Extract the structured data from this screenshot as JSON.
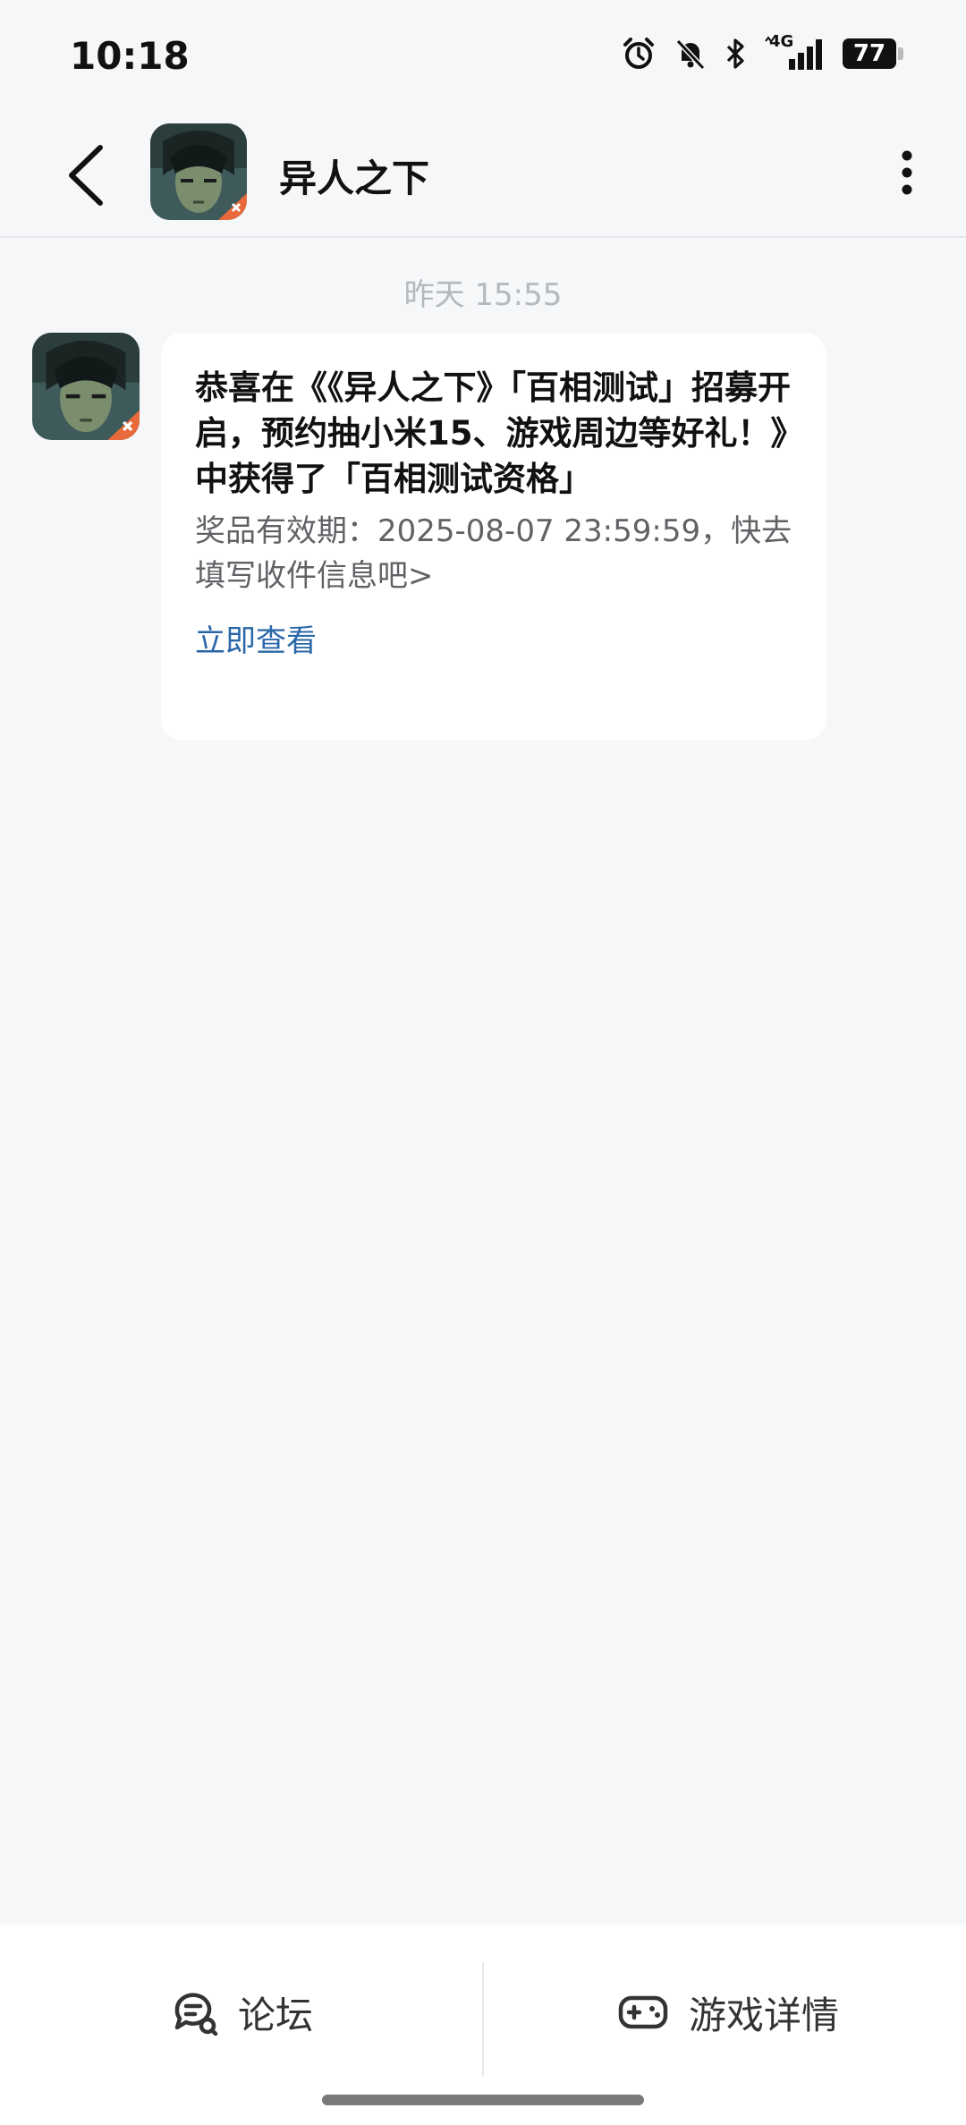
{
  "status_bar": {
    "time": "10:18",
    "network": "4G",
    "battery": "77"
  },
  "header": {
    "title": "异人之下",
    "avatar": "game-avatar"
  },
  "chat": {
    "timestamp": "昨天  15:55",
    "message": {
      "title": "恭喜在《《异人之下》「百相测试」招募开启，预约抽小米15、游戏周边等好礼！》中获得了「百相测试资格」",
      "description": "奖品有效期：2025-08-07 23:59:59，快去填写收件信息吧>",
      "link_label": "立即查看"
    }
  },
  "bottom_nav": {
    "forum_label": "论坛",
    "game_detail_label": "游戏详情"
  },
  "icons": {
    "back": "back-arrow-icon",
    "more": "more-vertical-icon",
    "forum": "forum-chat-icon",
    "game": "gamepad-icon"
  }
}
